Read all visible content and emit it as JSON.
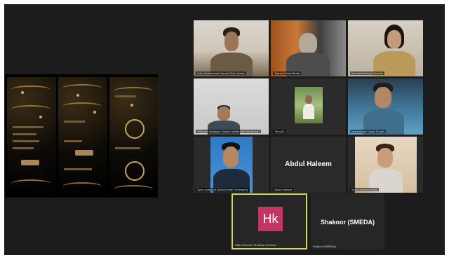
{
  "screen_share": {
    "label": "Shared screen",
    "phones": [
      "phone-1",
      "phone-2",
      "phone-3"
    ]
  },
  "participants": [
    {
      "id": "p1",
      "label": "Hafiz Muhammad Usman Shah (Host)",
      "kind": "video"
    },
    {
      "id": "p2",
      "label": "Taimur Fahad Bhatti",
      "kind": "video"
    },
    {
      "id": "p3",
      "label": "Iqra Ashraf Nasir Qureshi",
      "kind": "video"
    },
    {
      "id": "p4",
      "label": "Tehmoor Saddique (Senior Mobile App Developer)",
      "kind": "video"
    },
    {
      "id": "p5",
      "label": "Tariq Ali",
      "kind": "photo"
    },
    {
      "id": "p6",
      "label": "Muhammad Zubair Shahid",
      "kind": "video"
    },
    {
      "id": "p7",
      "label": "Syed Junaid Ali Shah (Flutter Developer)",
      "kind": "video"
    },
    {
      "id": "p8",
      "label": "Abdul Haleem",
      "display_name": "Abdul Haleem",
      "kind": "name"
    },
    {
      "id": "p9",
      "label": "Syed Mubashir Shah",
      "kind": "video"
    }
  ],
  "active_speaker": {
    "initials": "Hk",
    "avatar_color": "#c23663",
    "label": "Hafiz Khurram Shahzad (Trainer)",
    "border_color": "#d7d65a"
  },
  "shakoor": {
    "display_name": "Shakoor (SMEDA)",
    "label": "Shakoor (SMEDA)"
  }
}
